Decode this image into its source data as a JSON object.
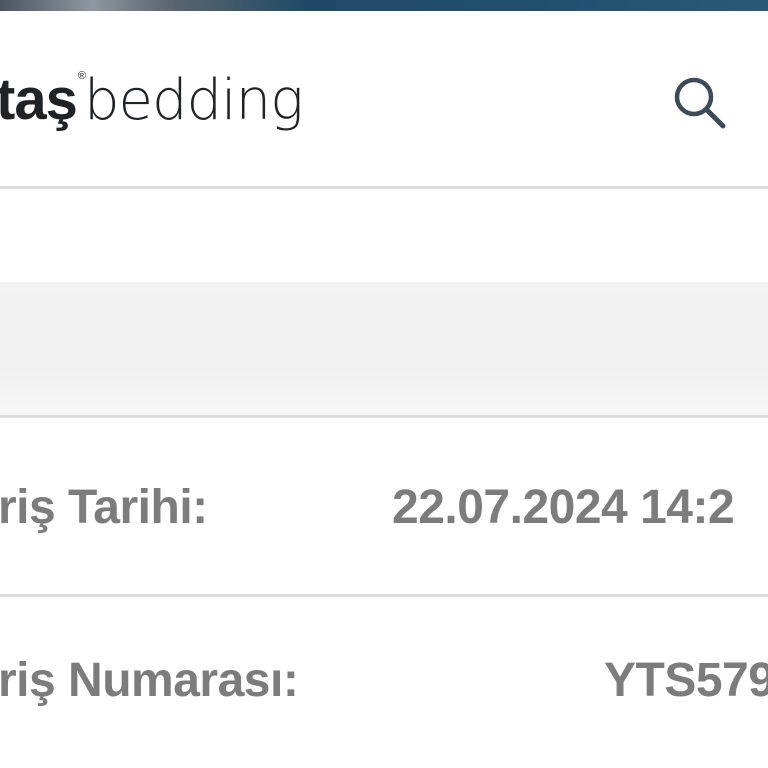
{
  "header": {
    "logo": {
      "bold": "taş",
      "registered": "®",
      "light": "bedding"
    },
    "search_icon": "search-icon"
  },
  "order_info": {
    "rows": [
      {
        "label": "riş Tarihi:",
        "value": "22.07.2024 14:2"
      },
      {
        "label": "riş Numarası:",
        "value": "YTS579"
      }
    ]
  },
  "colors": {
    "text_dark": "#1f2326",
    "text_muted": "#7c7c7c",
    "divider": "#dcdcdc",
    "band": "#f0f0f0"
  }
}
